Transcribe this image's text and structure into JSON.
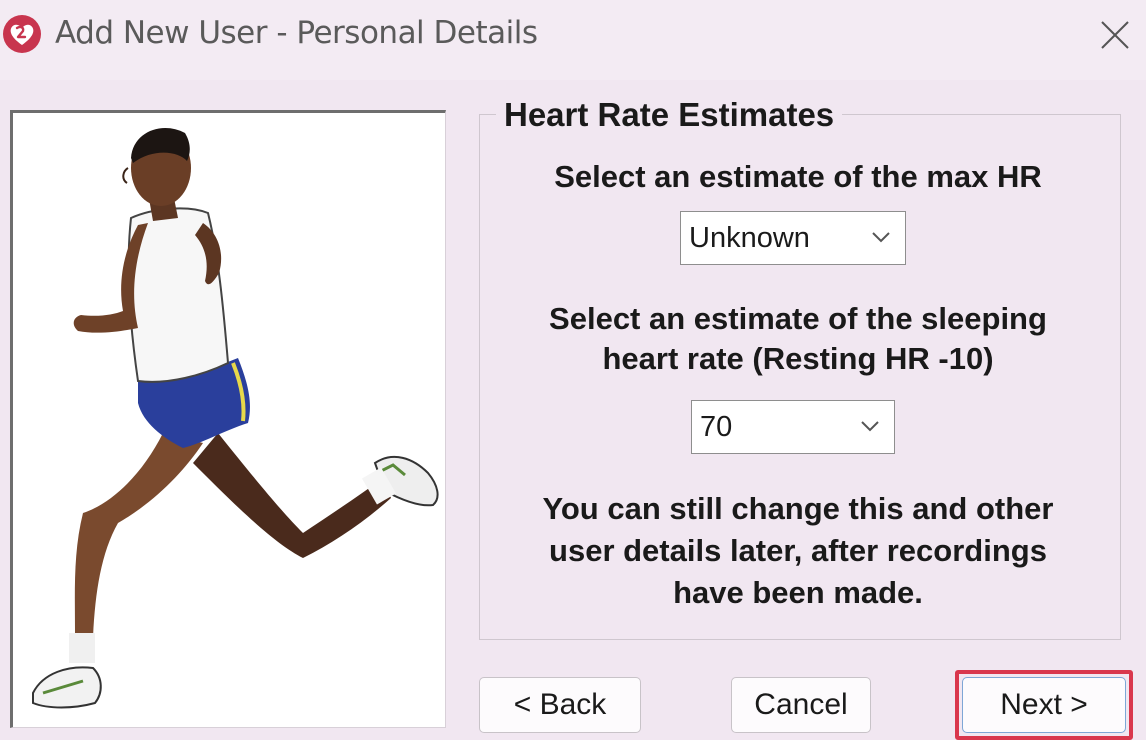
{
  "window": {
    "title": "Add New User - Personal Details",
    "app_icon": "heart-logo-icon",
    "close_icon": "close-icon"
  },
  "group": {
    "title": "Heart Rate Estimates",
    "max_hr_label": "Select an estimate of the  max HR",
    "max_hr_value": "Unknown",
    "sleep_hr_label_line1": "Select an estimate of the sleeping",
    "sleep_hr_label_line2": "heart rate (Resting HR -10)",
    "sleep_hr_value": "70",
    "note_line1": "You can still change this and other",
    "note_line2": "user details later, after recordings",
    "note_line3": "have been made."
  },
  "buttons": {
    "back": "< Back",
    "cancel": "Cancel",
    "next": "Next >"
  },
  "colors": {
    "background": "#f1e7f1",
    "highlight": "#d9374d",
    "icon_red": "#c8354e",
    "shorts_blue": "#2a3f9c"
  }
}
